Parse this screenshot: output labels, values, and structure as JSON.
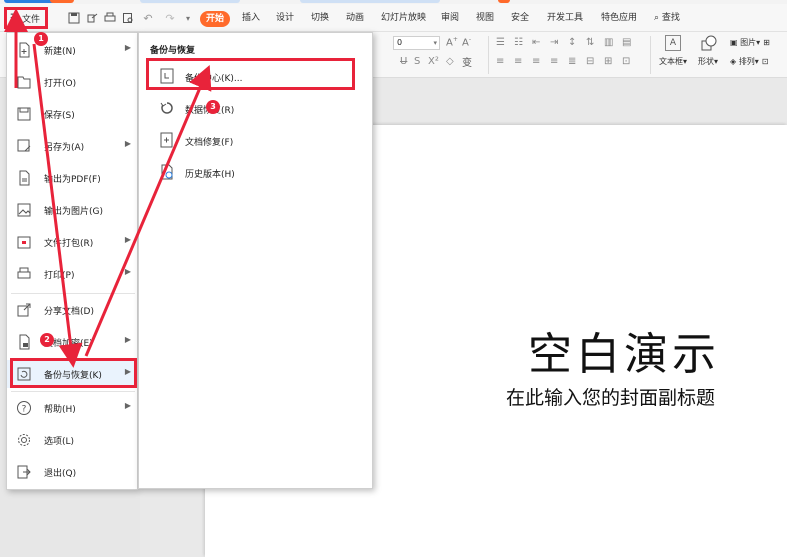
{
  "app": {
    "file_button": "文件",
    "tabs": [
      "开始",
      "插入",
      "设计",
      "切换",
      "动画",
      "幻灯片放映",
      "审阅",
      "视图",
      "安全",
      "开发工具",
      "特色应用"
    ],
    "search_label": "查找",
    "tab_colors": [
      "#2b7fe0",
      "#ff6a2b",
      "#2b7fe0",
      "#ff6a2b"
    ]
  },
  "ribbon": {
    "font_size_value": "0",
    "textbox_label": "文本框",
    "shape_label": "形状",
    "picture_label": "图片",
    "arrange_label": "排列"
  },
  "file_menu": {
    "items": [
      {
        "label": "新建(N)",
        "icon": "new-doc-icon",
        "has_arrow": true
      },
      {
        "label": "打开(O)",
        "icon": "folder-open-icon",
        "has_arrow": false
      },
      {
        "label": "保存(S)",
        "icon": "save-icon",
        "has_arrow": false
      },
      {
        "label": "另存为(A)",
        "icon": "save-as-icon",
        "has_arrow": true
      },
      {
        "label": "输出为PDF(F)",
        "icon": "pdf-icon",
        "has_arrow": false
      },
      {
        "label": "输出为图片(G)",
        "icon": "image-export-icon",
        "has_arrow": false
      },
      {
        "label": "文件打包(R)",
        "icon": "package-icon",
        "has_arrow": true
      },
      {
        "label": "打印(P)",
        "icon": "print-icon",
        "has_arrow": true
      },
      {
        "label": "分享文档(D)",
        "icon": "share-icon",
        "has_arrow": false
      },
      {
        "label": "文档加密(E)",
        "icon": "encrypt-icon",
        "has_arrow": true
      },
      {
        "label": "备份与恢复(K)",
        "icon": "backup-icon",
        "has_arrow": true
      },
      {
        "label": "帮助(H)",
        "icon": "help-icon",
        "has_arrow": true
      },
      {
        "label": "选项(L)",
        "icon": "gear-icon",
        "has_arrow": false
      },
      {
        "label": "退出(Q)",
        "icon": "exit-icon",
        "has_arrow": false
      }
    ]
  },
  "sub_menu": {
    "title": "备份与恢复",
    "items": [
      {
        "label": "备份中心(K)...",
        "icon": "backup-center-icon"
      },
      {
        "label": "数据恢复(R)",
        "icon": "restore-icon"
      },
      {
        "label": "文档修复(F)",
        "icon": "doc-repair-icon"
      },
      {
        "label": "历史版本(H)",
        "icon": "history-icon"
      }
    ]
  },
  "slide": {
    "title": "空白演示",
    "subtitle": "在此输入您的封面副标题"
  },
  "annotations": {
    "badges": [
      "1",
      "2",
      "3"
    ],
    "color": "#e8233a"
  }
}
